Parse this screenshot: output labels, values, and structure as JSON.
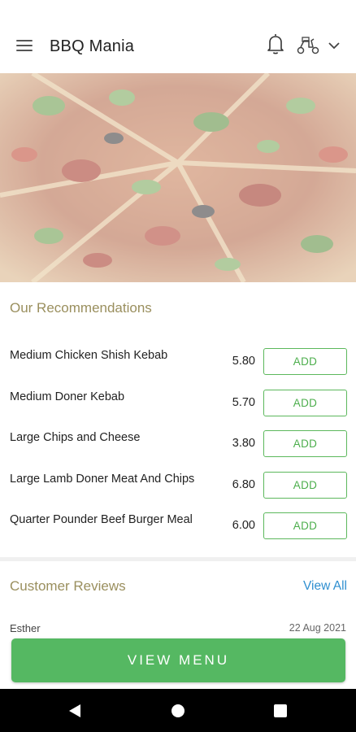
{
  "header": {
    "title": "BBQ Mania",
    "icons": [
      "menu-icon",
      "bell-icon",
      "delivery-scooter-icon",
      "chevron-down-icon"
    ]
  },
  "hero": {
    "icon": "pizza-photo"
  },
  "recommendations": {
    "title": "Our Recommendations",
    "items": [
      {
        "name": "Medium Chicken Shish Kebab",
        "price": "5.80",
        "button": "ADD"
      },
      {
        "name": "Medium Doner Kebab",
        "price": "5.70",
        "button": "ADD"
      },
      {
        "name": "Large Chips and Cheese",
        "price": "3.80",
        "button": "ADD"
      },
      {
        "name": "Large Lamb Doner Meat And Chips",
        "price": "6.80",
        "button": "ADD"
      },
      {
        "name": "Quarter Pounder Beef Burger Meal",
        "price": "6.00",
        "button": "ADD"
      }
    ]
  },
  "reviews": {
    "title": "Customer Reviews",
    "view_all": "View All",
    "items": [
      {
        "author": "Esther",
        "date": "22 Aug 2021"
      }
    ]
  },
  "cta": {
    "label": "VIEW MENU"
  },
  "colors": {
    "accent_green": "#55b862",
    "section_title": "#9a8f5e",
    "link_blue": "#2f8fd0"
  },
  "system_nav": {
    "icons": [
      "back-icon",
      "home-icon",
      "recents-icon"
    ]
  }
}
